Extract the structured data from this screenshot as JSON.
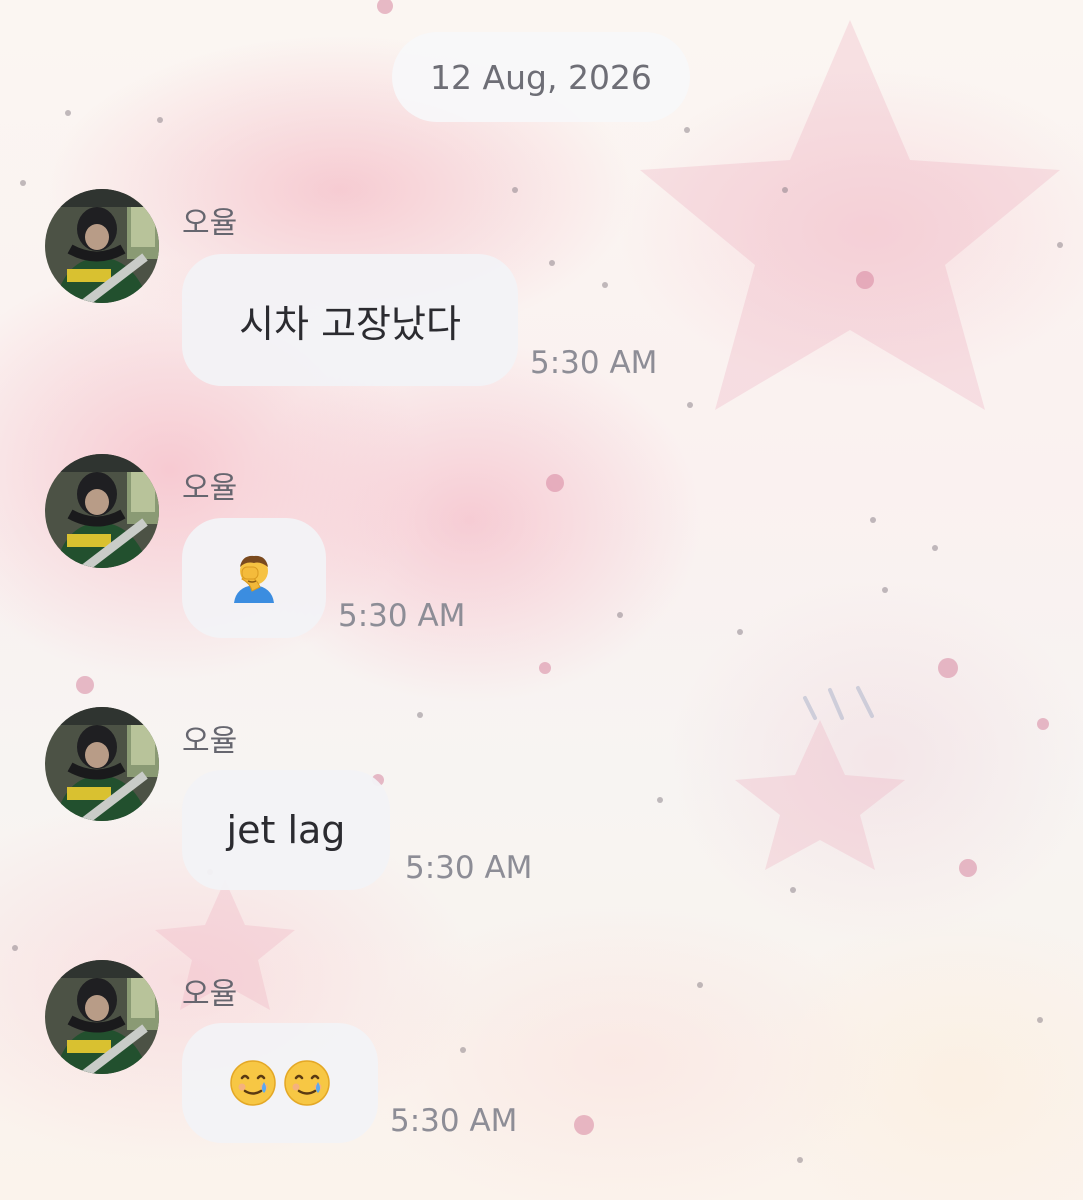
{
  "chat": {
    "date_label": "12 Aug, 2026",
    "messages": [
      {
        "sender": "오율",
        "text": "시차 고장났다",
        "time": "5:30 AM"
      },
      {
        "sender": "오율",
        "emoji": [
          "face-palm-icon"
        ],
        "time": "5:30 AM"
      },
      {
        "sender": "오율",
        "text": "jet lag",
        "time": "5:30 AM"
      },
      {
        "sender": "오율",
        "emoji": [
          "smiling-face-with-tear-icon",
          "smiling-face-with-tear-icon"
        ],
        "time": "5:30 AM"
      }
    ]
  },
  "colors": {
    "bubble": "#f3f3f6",
    "date_pill": "#f8f8fa",
    "timestamp": "#8d8d96",
    "sender": "#66666f",
    "background_pink": "#f6c0ca"
  }
}
